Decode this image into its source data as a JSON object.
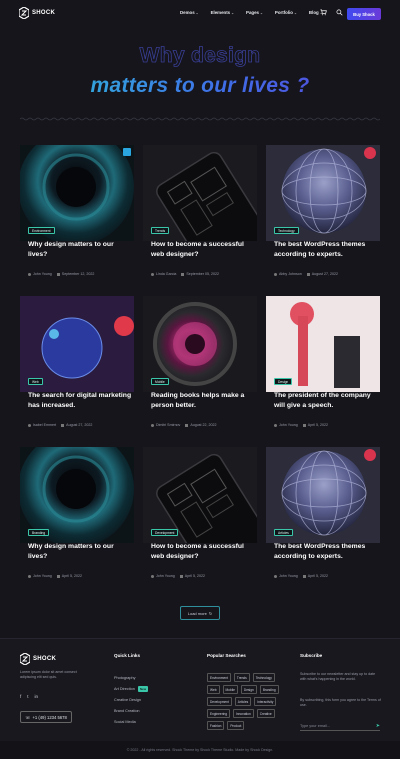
{
  "nav": {
    "brand": "SHOCK",
    "menu": [
      {
        "label": "Demos"
      },
      {
        "label": "Elements"
      },
      {
        "label": "Pages"
      },
      {
        "label": "Portfolio"
      },
      {
        "label": "Blog"
      }
    ],
    "buy_label": "Buy Shock"
  },
  "hero": {
    "line1": "Why design",
    "line2": "matters to our lives ?"
  },
  "cards": [
    {
      "tag": "Environment",
      "title": "Why design matters to our lives?",
      "author": "John Young",
      "date": "September 12, 2022",
      "image": "camera-lens-teal",
      "share": true
    },
    {
      "tag": "Trends",
      "title": "How to become a successful web designer?",
      "author": "Linda Garcia",
      "date": "September 05, 2022",
      "image": "phone-internals-dark"
    },
    {
      "tag": "Technology",
      "title": "The best WordPress themes according to experts.",
      "author": "Abby Johnson",
      "date": "August 27, 2022",
      "image": "wire-sphere-purple"
    },
    {
      "tag": "Web",
      "title": "The search for digital marketing has increased.",
      "author": "Isabel Emmert",
      "date": "August 27, 2022",
      "image": "blue-sculpture-red"
    },
    {
      "tag": "Mobile",
      "title": "Reading books helps make a person better.",
      "author": "Dimitri Smirnov",
      "date": "August 22, 2022",
      "image": "camera-lens-pink"
    },
    {
      "tag": "Design",
      "title": "The president of the company will give a speech.",
      "author": "John Young",
      "date": "April 5, 2022",
      "image": "red-rollup-pink"
    },
    {
      "tag": "Branding",
      "title": "Why design matters to our lives?",
      "author": "John Young",
      "date": "April 5, 2022",
      "image": "camera-lens-teal"
    },
    {
      "tag": "Development",
      "title": "How to become a successful web designer?",
      "author": "John Young",
      "date": "April 5, 2022",
      "image": "phone-internals-dark"
    },
    {
      "tag": "Articles",
      "title": "The best WordPress themes according to experts.",
      "author": "John Young",
      "date": "April 5, 2022",
      "image": "wire-sphere-purple"
    }
  ],
  "load_more": "Load more",
  "footer": {
    "brand": "SHOCK",
    "about": "Lorem ipsum dolor sit amet consect adipiscing elit sed quis.",
    "phone": "+1 (49) 1234 5678",
    "quick_links_title": "Quick Links",
    "quick_links": [
      "Photography",
      "Art Direction",
      "Creative Design",
      "Brand Creation",
      "Social Media"
    ],
    "new_badge": "New",
    "popular_title": "Popular Searches",
    "popular": [
      "Environment",
      "Trends",
      "Technology",
      "Web",
      "Mobile",
      "Design",
      "Branding",
      "Development",
      "Articles",
      "Interactivity",
      "Engineering",
      "Innovation",
      "Creative",
      "Fashion",
      "Product"
    ],
    "subscribe_title": "Subscribe",
    "subscribe_text": "Subscribe to our newsletter and stay up to date with what's happening in the world.",
    "subscribe_text2": "By subscribing, this form you agree to the Terms of use.",
    "email_placeholder": "Type your email...",
    "copyright": "© 2022 - All rights reserved. Shock Theme by Shock Theme Studio. Made by Shock Design."
  },
  "colors": {
    "accent_teal": "#3ac6a8",
    "accent_blue": "#3f4bf0",
    "bg": "#15151b"
  }
}
